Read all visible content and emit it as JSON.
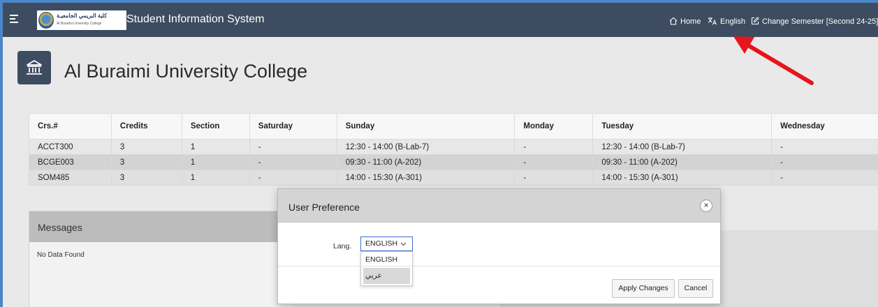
{
  "app": {
    "title": "Student Information System",
    "logo_arabic": "كلية البريمي الجامعيـة",
    "logo_english": "Al Buraimi University College"
  },
  "nav": {
    "home": "Home",
    "language": "English",
    "change_semester": "Change Semester [Second 24-25]"
  },
  "header": {
    "title": "Al Buraimi University College"
  },
  "schedule": {
    "columns": [
      "Crs.#",
      "Credits",
      "Section",
      "Saturday",
      "Sunday",
      "Monday",
      "Tuesday",
      "Wednesday"
    ],
    "rows": [
      [
        "ACCT300",
        "3",
        "1",
        "-",
        "12:30 - 14:00 (B-Lab-7)",
        "-",
        "12:30 - 14:00 (B-Lab-7)",
        "-"
      ],
      [
        "BCGE003",
        "3",
        "1",
        "-",
        "09:30 - 11:00 (A-202)",
        "-",
        "09:30 - 11:00 (A-202)",
        "-"
      ],
      [
        "SOM485",
        "3",
        "1",
        "-",
        "14:00 - 15:30 (A-301)",
        "-",
        "14:00 - 15:30 (A-301)",
        "-"
      ]
    ]
  },
  "messages": {
    "title": "Messages",
    "empty_text": "No Data Found"
  },
  "dialog": {
    "title": "User Preference",
    "close_symbol": "×",
    "lang_label": "Lang.",
    "lang_selected": "ENGLISH",
    "lang_options": [
      "ENGLISH",
      "عربي"
    ],
    "apply_label": "Apply Changes",
    "cancel_label": "Cancel"
  },
  "colors": {
    "topbar": "#3d4c60",
    "annotation_arrow": "#e8141b",
    "select_focus": "#3b6bd6"
  }
}
